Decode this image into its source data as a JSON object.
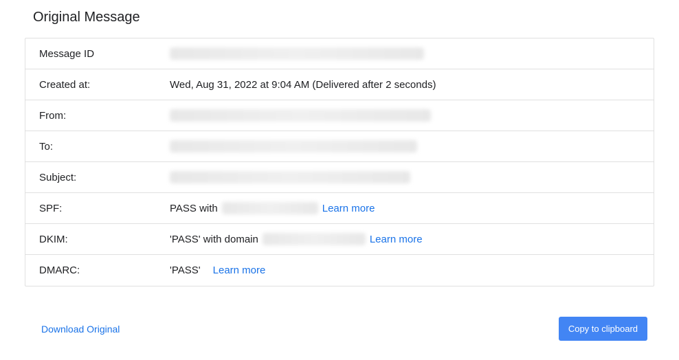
{
  "title": "Original Message",
  "rows": {
    "message_id": {
      "label": "Message ID"
    },
    "created_at": {
      "label": "Created at:",
      "value": "Wed, Aug 31, 2022 at 9:04 AM (Delivered after 2 seconds)"
    },
    "from": {
      "label": "From:"
    },
    "to": {
      "label": "To:"
    },
    "subject": {
      "label": "Subject:"
    },
    "spf": {
      "label": "SPF:",
      "prefix": "PASS with",
      "learn_more": "Learn more"
    },
    "dkim": {
      "label": "DKIM:",
      "prefix": "'PASS' with domain",
      "learn_more": "Learn more"
    },
    "dmarc": {
      "label": "DMARC:",
      "value": "'PASS'",
      "learn_more": "Learn more"
    }
  },
  "actions": {
    "download": "Download Original",
    "copy": "Copy to clipboard"
  },
  "colors": {
    "link": "#1a73e8",
    "button_bg": "#4285f4",
    "border": "#e0e0e0"
  }
}
